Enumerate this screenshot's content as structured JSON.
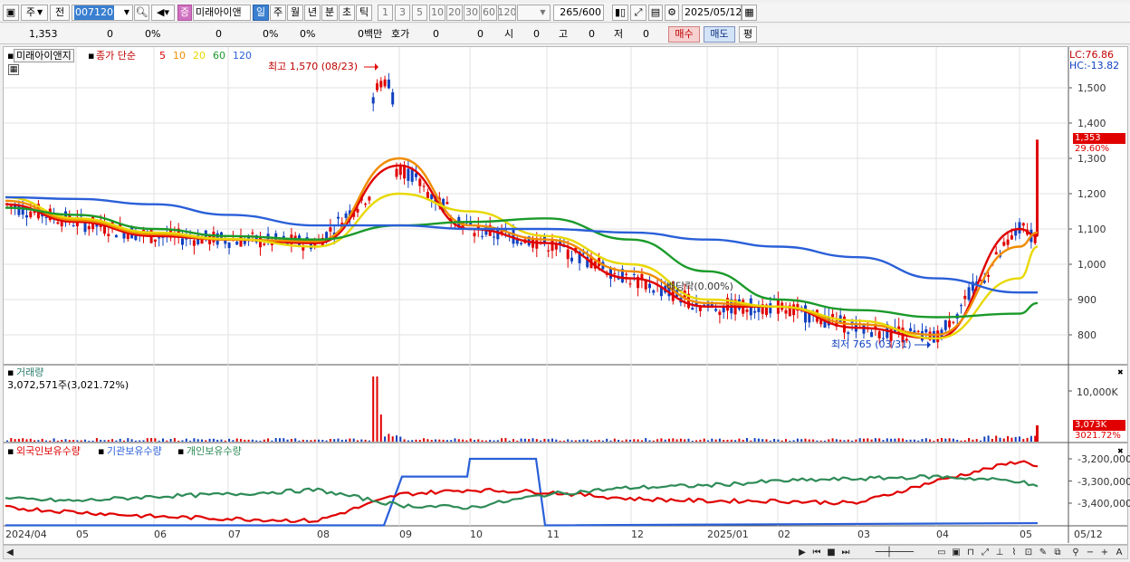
{
  "toolbar": {
    "period_type": "주",
    "prev_label": "전",
    "code": "007120",
    "security_badge": "증",
    "stock_name": "미래아이앤",
    "timeframes": [
      "일",
      "주",
      "월",
      "년",
      "분",
      "초",
      "틱"
    ],
    "selected_timeframe": "일",
    "intervals": [
      "1",
      "3",
      "5",
      "10",
      "20",
      "30",
      "60",
      "120"
    ],
    "count_value": "265",
    "count_max": "/600",
    "date": "2025/05/12"
  },
  "quote": {
    "price": "1,353",
    "change": "0",
    "change_pct": "0%",
    "volume": "0",
    "volume_pct": "0%",
    "rate": "0%",
    "amount": "0백만",
    "bid_ask_label": "호가",
    "bid": "0",
    "ask": "0",
    "open_label": "시",
    "open": "0",
    "high_label": "고",
    "high": "0",
    "low_label": "저",
    "low": "0",
    "buy_label": "매수",
    "sell_label": "매도",
    "avg_label": "평"
  },
  "price_panel": {
    "stock_label": "미래아이앤지",
    "ma_title": "종가 단순",
    "ma_periods": [
      {
        "label": "5",
        "color": "#e00000"
      },
      {
        "label": "10",
        "color": "#f08c00"
      },
      {
        "label": "20",
        "color": "#e8d800"
      },
      {
        "label": "60",
        "color": "#1a9a2a"
      },
      {
        "label": "120",
        "color": "#2a5fd8"
      }
    ],
    "lc": "LC:76.86",
    "hc": "HC:-13.82",
    "high_note": "최고 1,570 (08/23)",
    "low_note": "최저 765 (03/31)",
    "dividend_note": "배당락(0.00%)",
    "current_price_tag": "1,353",
    "current_pct_tag": "29.60%",
    "y_ticks": [
      "1,500",
      "1,400",
      "1,300",
      "1,200",
      "1,100",
      "1,000",
      "900",
      "800"
    ]
  },
  "volume_panel": {
    "title": "거래량",
    "value_text": "3,072,571주(3,021.72%)",
    "y_tick": "10,000K",
    "tag_value": "3,073K",
    "tag_pct": "3021.72%"
  },
  "holdings_panel": {
    "legends": [
      {
        "label": "외국인보유수량",
        "color": "#e00000"
      },
      {
        "label": "기관보유수량",
        "color": "#2a5fd8"
      },
      {
        "label": "개인보유수량",
        "color": "#2e8b57"
      }
    ],
    "y_ticks": [
      "-3,200,000",
      "-3,300,000",
      "-3,400,000"
    ]
  },
  "x_axis": [
    "2024/04",
    "05",
    "06",
    "07",
    "08",
    "09",
    "10",
    "11",
    "12",
    "2025/01",
    "02",
    "03",
    "04",
    "05",
    "05/12"
  ],
  "colors": {
    "up": "#e00000",
    "down": "#1040c0",
    "grid": "#e2e2e2",
    "accent": "#3a7fd0"
  },
  "chart_data": [
    {
      "type": "line",
      "title": "미래아이앤지",
      "x": [
        "2024/04",
        "05",
        "06",
        "07",
        "08",
        "09",
        "10",
        "11",
        "12",
        "2025/01",
        "02",
        "03",
        "04",
        "05",
        "05/12"
      ],
      "series": [
        {
          "name": "5",
          "values": [
            1170,
            1120,
            1080,
            1070,
            1060,
            1280,
            1100,
            1060,
            960,
            880,
            880,
            820,
            790,
            1100,
            1080
          ]
        },
        {
          "name": "10",
          "values": [
            1180,
            1125,
            1085,
            1070,
            1065,
            1300,
            1110,
            1070,
            980,
            890,
            880,
            830,
            800,
            1050,
            1090
          ]
        },
        {
          "name": "20",
          "values": [
            1190,
            1130,
            1090,
            1072,
            1050,
            1200,
            1150,
            1080,
            1000,
            900,
            880,
            840,
            790,
            960,
            1050
          ]
        },
        {
          "name": "60",
          "values": [
            1160,
            1140,
            1100,
            1080,
            1070,
            1110,
            1120,
            1130,
            1070,
            980,
            900,
            870,
            850,
            860,
            890
          ]
        },
        {
          "name": "120",
          "values": [
            1190,
            1185,
            1170,
            1140,
            1110,
            1110,
            1100,
            1100,
            1090,
            1070,
            1050,
            1020,
            960,
            920,
            920
          ]
        }
      ],
      "ylim": [
        730,
        1600
      ]
    },
    {
      "type": "bar",
      "title": "거래량",
      "annotations": [
        "3,072,571주(3,021.72%)"
      ],
      "ylim": [
        0,
        12000000
      ]
    },
    {
      "type": "line",
      "x": [
        "2024/04",
        "05",
        "06",
        "07",
        "08",
        "09",
        "10",
        "11",
        "12",
        "2025/01",
        "02",
        "03",
        "04",
        "05",
        "05/12"
      ],
      "series": [
        {
          "name": "외국인보유수량",
          "values": [
            -3420000,
            -3440000,
            -3460000,
            -3470000,
            -3480000,
            -3360000,
            -3340000,
            -3350000,
            -3380000,
            -3390000,
            -3390000,
            -3400000,
            -3300000,
            -3210000,
            -3230000
          ]
        },
        {
          "name": "기관보유수량",
          "values": [
            -3500000,
            -3500000,
            -3500000,
            -3500000,
            -3500000,
            -3280000,
            -3200000,
            -3500000,
            -3490000,
            -3490000,
            -3490000,
            -3490000,
            -3490000,
            -3490000,
            -3490000
          ]
        },
        {
          "name": "개인보유수량",
          "values": [
            -3380000,
            -3390000,
            -3370000,
            -3360000,
            -3340000,
            -3410000,
            -3420000,
            -3360000,
            -3330000,
            -3320000,
            -3300000,
            -3290000,
            -3280000,
            -3300000,
            -3330000
          ]
        }
      ],
      "ylim": [
        -3540000,
        -3170000
      ]
    }
  ]
}
